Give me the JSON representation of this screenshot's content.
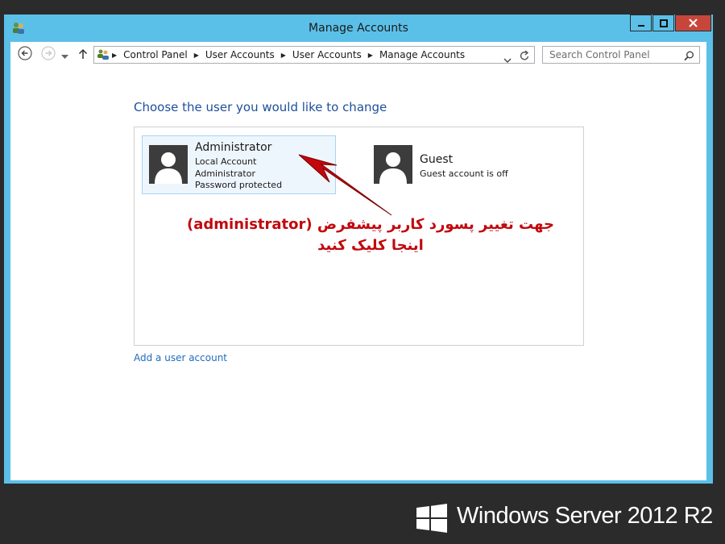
{
  "window": {
    "title": "Manage Accounts",
    "frame_color": "#5bc0e8",
    "close_color": "#c7463c",
    "buttons": {
      "minimize": "minimize-icon",
      "maximize": "maximize-icon",
      "close": "close-icon"
    }
  },
  "navigation": {
    "back_icon": "back-arrow-icon",
    "forward_icon": "forward-arrow-icon",
    "recent_icon": "chevron-down-icon",
    "up_icon": "up-arrow-icon",
    "breadcrumbs": [
      "Control Panel",
      "User Accounts",
      "User Accounts",
      "Manage Accounts"
    ],
    "search_placeholder": "Search Control Panel"
  },
  "main": {
    "heading": "Choose the user you would like to change",
    "accounts": [
      {
        "name": "Administrator",
        "details": [
          "Local Account",
          "Administrator",
          "Password protected"
        ]
      },
      {
        "name": "Guest",
        "details": [
          "Guest account is off"
        ]
      }
    ],
    "add_link": "Add a user account"
  },
  "annotation": {
    "line1": "جهت تغییر پسورد کاربر پیشفرض (administrator)",
    "line2": "اینجا کلیک کنید",
    "color": "#c2080d"
  },
  "branding": {
    "text": "Windows Server 2012 R2"
  }
}
